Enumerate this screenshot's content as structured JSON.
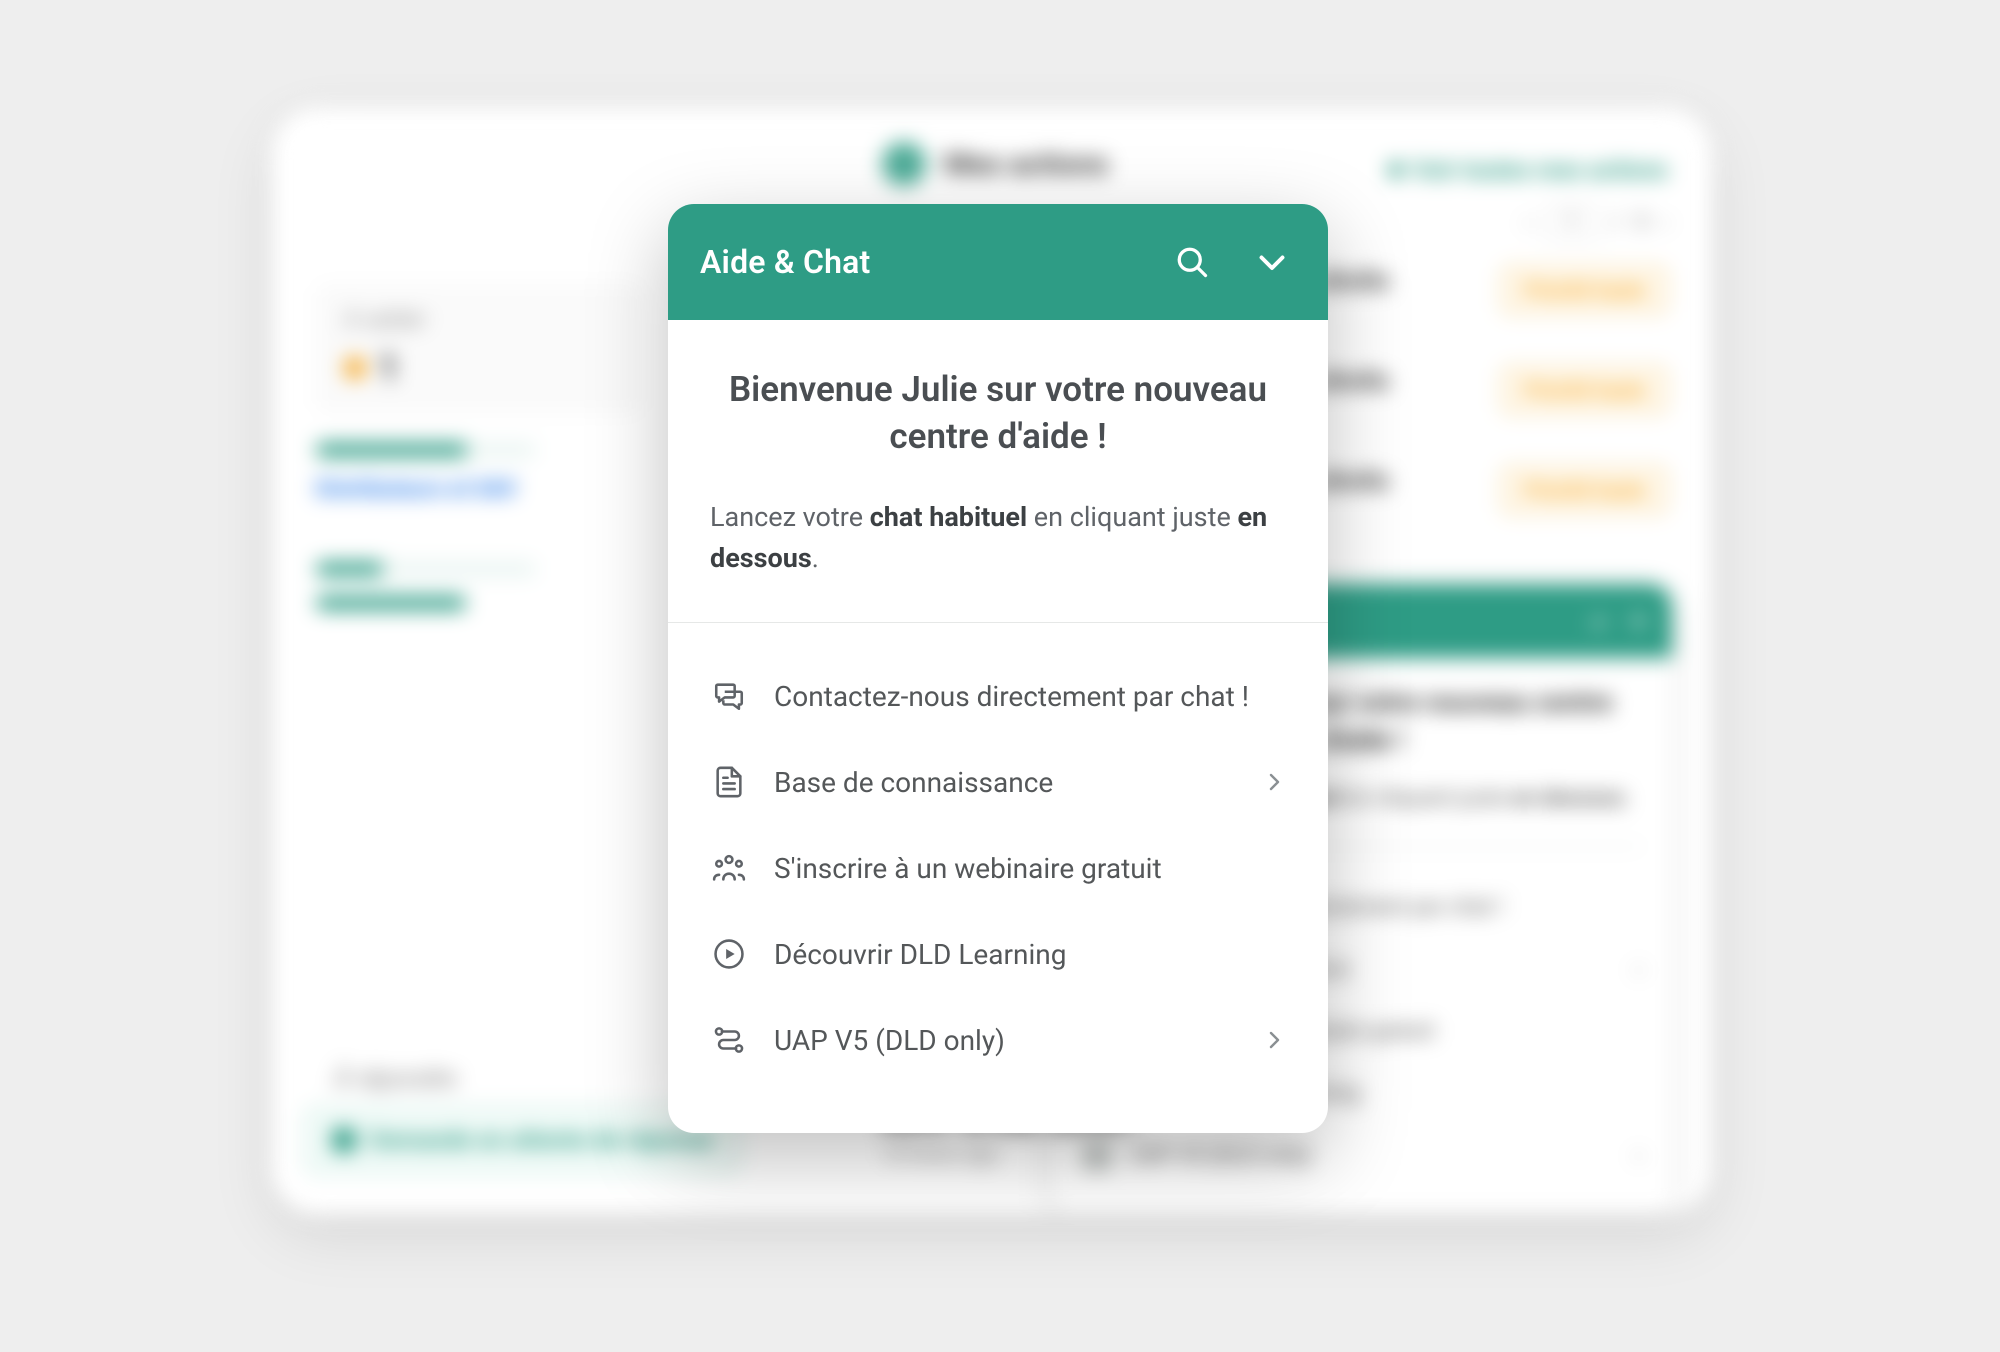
{
  "colors": {
    "accent": "#2e9c85",
    "amber": "#f5a623"
  },
  "background": {
    "actions_header": "Mes actions",
    "view_all": "Voir toutes mes actions",
    "pager": {
      "prev": "‹",
      "page": "1",
      "sep": "/",
      "total": "3",
      "next": "›"
    },
    "left_stat_label": "À valider",
    "left_stat_value": "1",
    "left_breakdown": "Distributeurs et SAV",
    "row_title": "Exercice des droits",
    "row_sub": "Clients",
    "row_badge": "Priorité haute",
    "bottom_label": "À répondre",
    "bottom_pill": "Demande en attente de réponse",
    "caption_title": "RGPD : la CNIL sanctio…",
    "caption_sub": "10 hours ago"
  },
  "help": {
    "header_title": "Aide & Chat",
    "welcome": "Bienvenue Julie sur votre nouveau centre d'aide !",
    "sub_parts": {
      "p1": "Lancez votre ",
      "b1": "chat habituel",
      "p2": " en cliquant juste ",
      "b2": "en dessous",
      "p3": "."
    },
    "items": [
      {
        "icon": "chat",
        "label": "Contactez-nous directement par chat !",
        "chevron": false
      },
      {
        "icon": "doc",
        "label": "Base de connaissance",
        "chevron": true
      },
      {
        "icon": "people",
        "label": "S'inscrire à un webinaire gratuit",
        "chevron": false
      },
      {
        "icon": "play",
        "label": "Découvrir DLD Learning",
        "chevron": false
      },
      {
        "icon": "route",
        "label": "UAP V5 (DLD only)",
        "chevron": true
      }
    ]
  }
}
